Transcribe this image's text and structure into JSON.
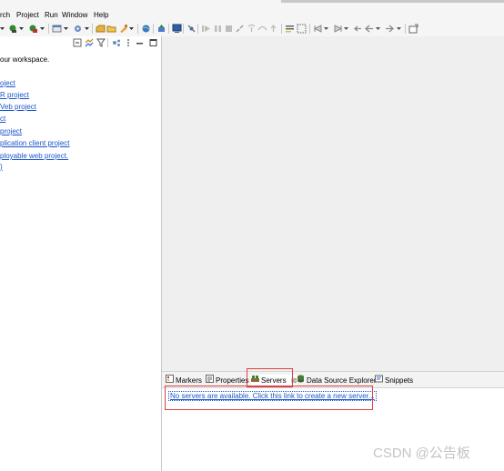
{
  "menu": {
    "items": [
      "rch",
      "Project",
      "Run",
      "Window",
      "Help"
    ]
  },
  "welcome": {
    "intro": "our workspace.",
    "links": [
      "oject",
      "R project",
      "Veb project",
      "ct",
      "project",
      "plication client project",
      "ployable web project.",
      ")"
    ]
  },
  "bottom_panel": {
    "tabs": {
      "markers": "Markers",
      "properties": "Properties",
      "servers": "Servers",
      "data_source_explorer": "Data Source Explorer",
      "snippets": "Snippets"
    },
    "servers_message": "No servers are available. Click this link to create a new server..."
  },
  "watermark": "CSDN @公告板",
  "colors": {
    "link": "#1a55c8",
    "highlight": "#e04040",
    "editor_bg": "#efefef"
  }
}
